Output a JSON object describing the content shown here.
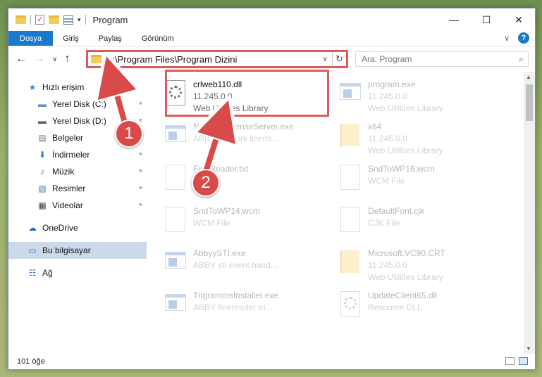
{
  "titlebar": {
    "title": "Program",
    "minimize": "—",
    "maximize": "☐",
    "close": "✕"
  },
  "ribbon": {
    "tabs": [
      "Dosya",
      "Giriş",
      "Paylaş",
      "Görünüm"
    ],
    "expand_glyph": "∨",
    "help": "?"
  },
  "nav": {
    "back": "←",
    "forward": "→",
    "recent": "∨",
    "up": "↑"
  },
  "address": {
    "path": "C:\\Program Files\\Program Dizini",
    "dropdown": "∨",
    "refresh": "↻"
  },
  "search": {
    "placeholder": "Ara: Program",
    "icon": "⌕"
  },
  "sidebar": {
    "items": [
      {
        "label": "Hızlı erişim",
        "icon": "star-icon",
        "glyph": "★",
        "color": "#3a86d8",
        "pinned": false,
        "head": true
      },
      {
        "label": "Yerel Disk (C:)",
        "icon": "drive-icon",
        "glyph": "▬",
        "color": "#6b8fb5",
        "pinned": true
      },
      {
        "label": "Yerel Disk (D:)",
        "icon": "drive-icon",
        "glyph": "▬",
        "color": "#666",
        "pinned": true
      },
      {
        "label": "Belgeler",
        "icon": "documents-icon",
        "glyph": "▤",
        "color": "#7a7a7a",
        "pinned": true
      },
      {
        "label": "İndirmeler",
        "icon": "downloads-icon",
        "glyph": "⬇",
        "color": "#2f7ad8",
        "pinned": true
      },
      {
        "label": "Müzik",
        "icon": "music-icon",
        "glyph": "♪",
        "color": "#2f7ad8",
        "pinned": true
      },
      {
        "label": "Resimler",
        "icon": "pictures-icon",
        "glyph": "▧",
        "color": "#4a7cb0",
        "pinned": true
      },
      {
        "label": "Videolar",
        "icon": "videos-icon",
        "glyph": "▦",
        "color": "#444",
        "pinned": true
      },
      {
        "label": "OneDrive",
        "icon": "cloud-icon",
        "glyph": "☁",
        "color": "#1f6fc9",
        "pinned": false,
        "head": true
      },
      {
        "label": "Bu bilgisayar",
        "icon": "computer-icon",
        "glyph": "▭",
        "color": "#2f7ad8",
        "pinned": false,
        "head": true,
        "active": true
      },
      {
        "label": "Ağ",
        "icon": "network-icon",
        "glyph": "☷",
        "color": "#2f7ad8",
        "pinned": false,
        "head": true
      }
    ],
    "pin_glyph": "⌖"
  },
  "files": [
    {
      "name": "crlweb110.dll",
      "line2": "11.245.0.0",
      "line3": "Web Utilities Library",
      "type": "dll",
      "faded": false
    },
    {
      "name": "program.exe",
      "line2": "11.245.0.0",
      "line3": "Web Utilities Library",
      "type": "exe2",
      "faded": true
    },
    {
      "name": "NetworkLicenseServer.exe",
      "line2": "ABBY network licens...",
      "line3": "",
      "type": "exe",
      "faded": true
    },
    {
      "name": "x64",
      "line2": "11.245.0.0",
      "line3": "Web Utilities Library",
      "type": "folder",
      "faded": true
    },
    {
      "name": "FineReader.txt",
      "line2": "File",
      "line3": "",
      "type": "doc",
      "faded": true
    },
    {
      "name": "SndToWP16.wcm",
      "line2": "WCM File",
      "line3": "",
      "type": "doc",
      "faded": true
    },
    {
      "name": "SndToWP14.wcm",
      "line2": "WCM File",
      "line3": "",
      "type": "doc",
      "faded": true
    },
    {
      "name": "DefaultFont.cjk",
      "line2": "CJK File",
      "line3": "",
      "type": "doc",
      "faded": true
    },
    {
      "name": "AbbyySTI.exe",
      "line2": "ABBY sti event hand...",
      "line3": "",
      "type": "exe",
      "faded": true
    },
    {
      "name": "Microsoft.VC90.CRT",
      "line2": "11.245.0.0",
      "line3": "Web Utilities Library",
      "type": "folder",
      "faded": true
    },
    {
      "name": "TrigrammsInstaller.exe",
      "line2": "ABBY finereader tri...",
      "line3": "",
      "type": "exe",
      "faded": true
    },
    {
      "name": "UpdateClient65.dll",
      "line2": "Resource DLL",
      "line3": "",
      "type": "dll",
      "faded": true
    }
  ],
  "status": {
    "count": "101 öğe"
  },
  "annotations": {
    "badge1": "1",
    "badge2": "2",
    "color": "#d94a4a"
  }
}
